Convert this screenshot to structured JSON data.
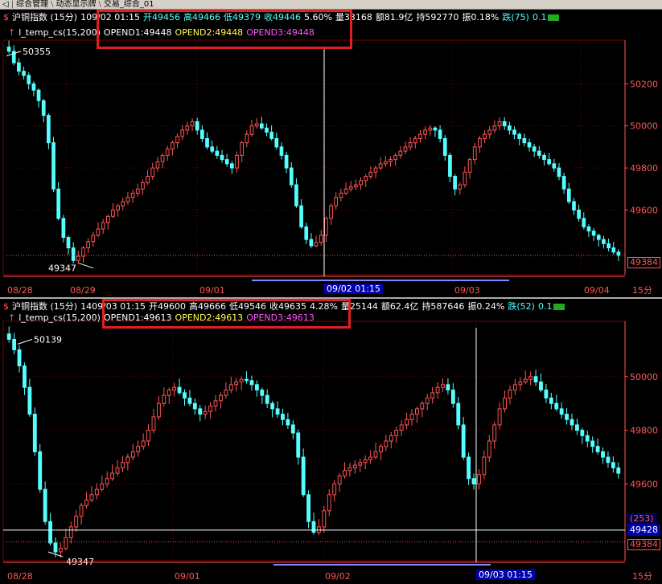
{
  "tabs": {
    "items": [
      "综合管理",
      "动态显示牌",
      "交易_综合_01"
    ]
  },
  "panel1": {
    "title": "沪铜指数 (15分)",
    "date_prefix": "1",
    "datetime": "09/02 01:15",
    "open": "开49456",
    "high": "高49466",
    "low": "低49379",
    "close": "收49446",
    "change_pct": "5.60%",
    "volume": "量33168",
    "amount": "额81.9亿",
    "hold": "持592770",
    "swing": "振0.18%",
    "fall": "跌(75)",
    "fall_pct": "0.1",
    "indicator": "l_temp_cs(15,200)",
    "opend1": "OPEND1:49448",
    "opend2": "OPEND2:49448",
    "opend3": "OPEND3:49448",
    "annot_high": "50355",
    "annot_low": "49347",
    "last_price": "49384",
    "cursor_date": "09/02 01:15",
    "period": "15分",
    "date_axis": [
      "08/28",
      "08/29",
      "09/01",
      "09/03",
      "09/04"
    ]
  },
  "panel2": {
    "title": "沪铜指数 (15分)",
    "date_prefix": "14",
    "datetime": "09/03 01:15",
    "open": "开49600",
    "high": "高49666",
    "low": "低49546",
    "close": "收49635",
    "change_pct": "4.28%",
    "volume": "量25144",
    "amount": "额62.4亿",
    "hold": "持587646",
    "swing": "振0.24%",
    "fall": "跌(52)",
    "fall_pct": "0.1",
    "indicator": "l_temp_cs(15,200)",
    "opend1": "OPEND1:49613",
    "opend2": "OPEND2:49613",
    "opend3": "OPEND3:49613",
    "annot_high": "50139",
    "annot_low": "49347",
    "count_tag": "(253)",
    "cursor_price": "49428",
    "last_price": "49384",
    "cursor_date": "09/03 01:15",
    "period": "15分",
    "date_axis": [
      "08/28",
      "09/01",
      "09/02"
    ]
  },
  "colors": {
    "up": "#ff5555",
    "down": "#55ffff",
    "grid": "#7a0000",
    "highlight": "#e02020"
  },
  "chart_data": [
    {
      "type": "candlestick",
      "title": "沪铜指数 (15分)",
      "y_ticks": [
        50200,
        50000,
        49800,
        49600
      ],
      "ylim": [
        49300,
        50400
      ],
      "x_labels": [
        "08/28",
        "08/29",
        "09/01",
        "09/02 01:15",
        "09/03",
        "09/04"
      ],
      "close_path": [
        50355,
        50300,
        50260,
        50240,
        50200,
        50170,
        50120,
        50050,
        49920,
        49700,
        49560,
        49470,
        49420,
        49360,
        49380,
        49420,
        49450,
        49480,
        49510,
        49540,
        49570,
        49600,
        49620,
        49640,
        49660,
        49680,
        49700,
        49730,
        49760,
        49800,
        49830,
        49860,
        49890,
        49920,
        49950,
        49980,
        50000,
        50020,
        49980,
        49940,
        49900,
        49880,
        49860,
        49840,
        49820,
        49800,
        49860,
        49920,
        49960,
        50000,
        50010,
        49990,
        49970,
        49940,
        49900,
        49860,
        49800,
        49720,
        49620,
        49520,
        49460,
        49430,
        49446,
        49480,
        49560,
        49620,
        49660,
        49680,
        49700,
        49710,
        49720,
        49740,
        49760,
        49780,
        49800,
        49820,
        49830,
        49840,
        49860,
        49880,
        49900,
        49920,
        49940,
        49960,
        49980,
        49990,
        49980,
        49940,
        49860,
        49760,
        49700,
        49720,
        49780,
        49840,
        49900,
        49940,
        49960,
        49980,
        50000,
        50020,
        50000,
        49980,
        49960,
        49940,
        49920,
        49900,
        49880,
        49860,
        49840,
        49820,
        49800,
        49760,
        49700,
        49640,
        49600,
        49560,
        49520,
        49500,
        49480,
        49460,
        49440,
        49420,
        49400,
        49384
      ],
      "annotations": {
        "high": 50355,
        "low": 49347,
        "last": 49384
      }
    },
    {
      "type": "candlestick",
      "title": "沪铜指数 (15分)",
      "y_ticks": [
        50000,
        49800,
        49600
      ],
      "ylim": [
        49320,
        50200
      ],
      "x_labels": [
        "08/28",
        "09/01",
        "09/02",
        "09/03 01:15"
      ],
      "close_path": [
        50139,
        50100,
        50040,
        49960,
        49860,
        49720,
        49580,
        49460,
        49380,
        49347,
        49360,
        49400,
        49440,
        49480,
        49520,
        49540,
        49560,
        49580,
        49600,
        49620,
        49640,
        49660,
        49680,
        49700,
        49720,
        49740,
        49760,
        49800,
        49850,
        49900,
        49930,
        49950,
        49960,
        49940,
        49920,
        49900,
        49880,
        49860,
        49870,
        49890,
        49910,
        49930,
        49950,
        49970,
        49980,
        49990,
        49985,
        49970,
        49950,
        49930,
        49900,
        49880,
        49860,
        49840,
        49820,
        49790,
        49700,
        49560,
        49460,
        49420,
        49440,
        49500,
        49560,
        49600,
        49630,
        49650,
        49660,
        49670,
        49680,
        49690,
        49700,
        49720,
        49740,
        49760,
        49780,
        49800,
        49820,
        49840,
        49860,
        49880,
        49900,
        49920,
        49940,
        49960,
        49970,
        49950,
        49900,
        49820,
        49700,
        49620,
        49600,
        49635,
        49700,
        49760,
        49820,
        49880,
        49920,
        49950,
        49970,
        49980,
        49990,
        50000,
        49980,
        49950,
        49920,
        49900,
        49880,
        49860,
        49840,
        49820,
        49800,
        49780,
        49760,
        49740,
        49720,
        49700,
        49680,
        49660,
        49640
      ],
      "annotations": {
        "high": 50139,
        "low": 49347,
        "cursor": 49428,
        "last": 49384
      }
    }
  ]
}
